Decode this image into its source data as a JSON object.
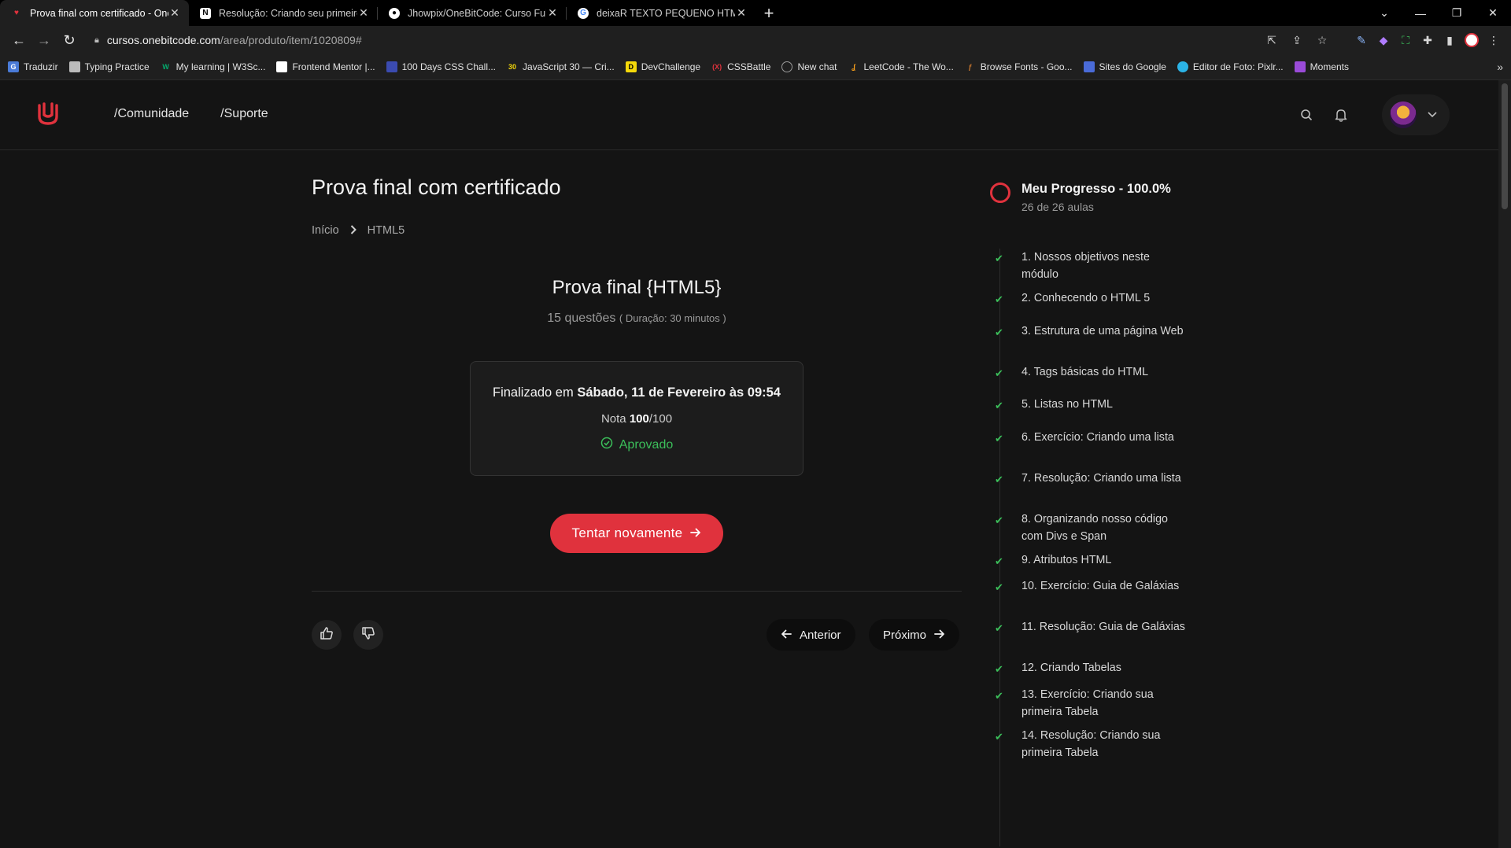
{
  "browser": {
    "tabs": [
      {
        "title": "Prova final com certificado - One",
        "fav_color": "#e0323d",
        "fav_glyph": "♥"
      },
      {
        "title": "Resolução: Criando seu primeiro",
        "fav_color": "#ffffff",
        "fav_glyph": "N"
      },
      {
        "title": "Jhowpix/OneBitCode: Curso FullS",
        "fav_color": "#ffffff",
        "fav_glyph": "●"
      },
      {
        "title": "deixaR TEXTO PEQUENO HTML -",
        "fav_color": "#ffffff",
        "fav_glyph": "G"
      }
    ],
    "new_tab": "+",
    "url_host": "cursos.onebitcode.com",
    "url_path": "/area/produto/item/1020809#",
    "bookmarks": [
      {
        "label": "Traduzir",
        "color": "#4a7bd8"
      },
      {
        "label": "Typing Practice",
        "color": "#bbbbbb"
      },
      {
        "label": "My learning | W3Sc...",
        "color": "#04aa6d"
      },
      {
        "label": "Frontend Mentor |...",
        "color": "#ffffff"
      },
      {
        "label": "100 Days CSS Chall...",
        "color": "#3b4bb0"
      },
      {
        "label": "JavaScript 30 — Cri...",
        "color": "#2a2a2a"
      },
      {
        "label": "DevChallenge",
        "color": "#f5d90a"
      },
      {
        "label": "CSSBattle",
        "color": "#e0323d"
      },
      {
        "label": "New chat",
        "color": "#9a9a9a"
      },
      {
        "label": "LeetCode - The Wo...",
        "color": "#f89f1b"
      },
      {
        "label": "Browse Fonts - Goo...",
        "color": "#c9772e"
      },
      {
        "label": "Sites do Google",
        "color": "#4a6bd8"
      },
      {
        "label": "Editor de Foto: Pixlr...",
        "color": "#2bb3e6"
      },
      {
        "label": "Moments",
        "color": "#9a4bd8"
      }
    ],
    "bookmarks_more": "»"
  },
  "header": {
    "nav": [
      "/Comunidade",
      "/Suporte"
    ]
  },
  "lesson": {
    "title": "Prova final com certificado",
    "breadcrumb": [
      "Início",
      "HTML5"
    ]
  },
  "exam": {
    "title": "Prova final {HTML5}",
    "questions": "15 questões",
    "duration": "( Duração: 30 minutos )",
    "finished_prefix": "Finalizado em ",
    "finished_date": "Sábado, 11 de Fevereiro às 09:54",
    "grade_label": "Nota ",
    "grade_value": "100",
    "grade_total": "/100",
    "status": "Aprovado",
    "retry_label": "Tentar novamente"
  },
  "pager": {
    "prev_label": "Anterior",
    "next_label": "Próximo"
  },
  "sidebar": {
    "progress_title": "Meu Progresso - 100.0%",
    "progress_sub": "26 de 26 aulas",
    "progress_fraction": 1.0,
    "lessons": [
      "1. Nossos objetivos neste módulo",
      "2. Conhecendo o HTML 5",
      "3. Estrutura de uma página Web",
      "4. Tags básicas do HTML",
      "5. Listas no HTML",
      "6. Exercício: Criando uma lista",
      "7. Resolução: Criando uma lista",
      "8. Organizando nosso código com Divs e Span",
      "9. Atributos HTML",
      "10. Exercício: Guia de Galáxias",
      "11. Resolução: Guia de Galáxias",
      "12. Criando Tabelas",
      "13. Exercício: Criando sua primeira Tabela",
      "14. Resolução: Criando sua primeira Tabela"
    ]
  },
  "colors": {
    "accent": "#e0323d",
    "success": "#3bbf5a",
    "background": "#141414"
  }
}
